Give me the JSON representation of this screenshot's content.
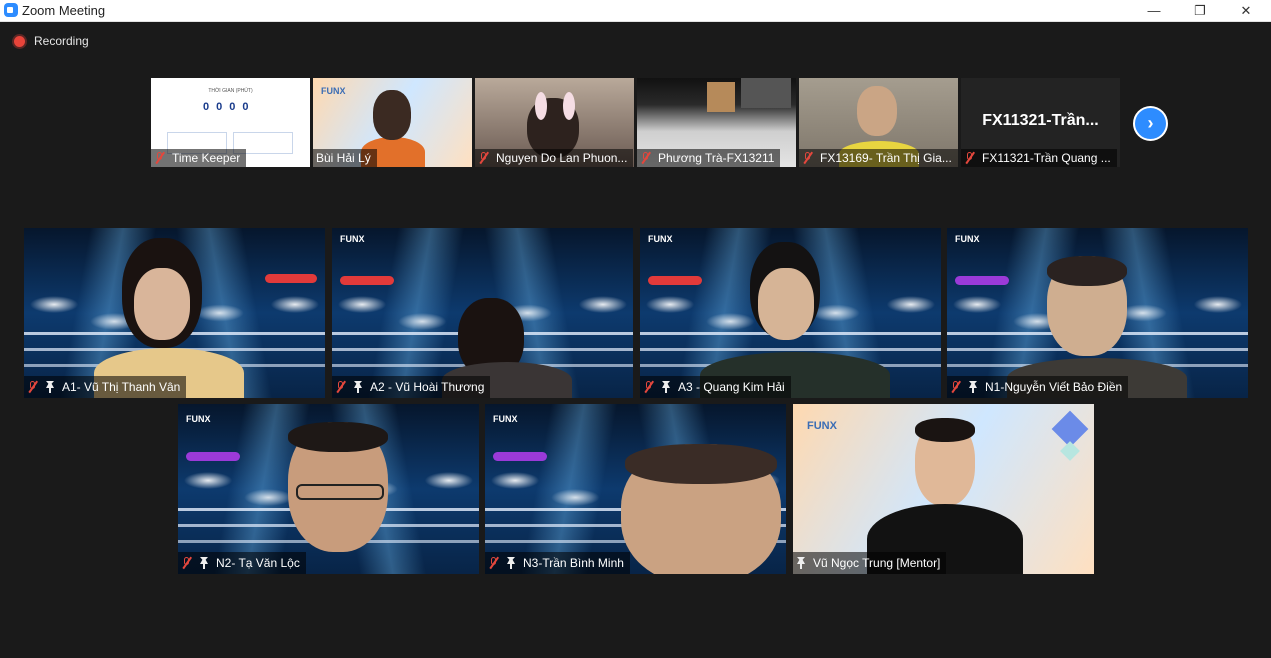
{
  "window": {
    "title": "Zoom Meeting",
    "icon": "zoom-icon"
  },
  "window_controls": {
    "minimize": "—",
    "restore": "❐",
    "close": "✕"
  },
  "recording": {
    "label": "Recording",
    "color": "#e8443a"
  },
  "doc_preview": {
    "title": "THỜI GIAN (PHÚT)",
    "digits": [
      "0",
      "0",
      "0",
      "0"
    ]
  },
  "gallery_strip": [
    {
      "name": "Time Keeper",
      "muted": true
    },
    {
      "name": "Bùi Hải Lý",
      "muted": false
    },
    {
      "name": "Nguyen Do Lan Phuon...",
      "muted": true
    },
    {
      "name": "Phương Trà-FX13211",
      "muted": true
    },
    {
      "name": "FX13169- Trần Thị Gia...",
      "muted": true
    },
    {
      "name": "FX11321-Trần Quang ...",
      "muted": true,
      "display_name": "FX11321-Trần..."
    }
  ],
  "next_page": {
    "icon": "chevron-right-icon",
    "label": "›"
  },
  "speakers": [
    {
      "name": "A1- Vũ Thị Thanh Vân",
      "muted": true,
      "pinned": true
    },
    {
      "name": "A2 - Vũ Hoài Thương",
      "muted": true,
      "pinned": true
    },
    {
      "name": "A3 - Quang Kim Hải",
      "muted": true,
      "pinned": true
    },
    {
      "name": "N1-Nguyễn Viết Bảo Điền",
      "muted": true,
      "pinned": true
    },
    {
      "name": "N2- Tạ Văn Lộc",
      "muted": true,
      "pinned": true
    },
    {
      "name": "N3-Trần Bình Minh",
      "muted": true,
      "pinned": true
    },
    {
      "name": "Vũ Ngọc Trung [Mentor]",
      "muted": false,
      "pinned": true
    }
  ],
  "brand": {
    "funx": "FUNX"
  },
  "colors": {
    "accent": "#2d8cff",
    "muted_red": "#e3473d"
  }
}
